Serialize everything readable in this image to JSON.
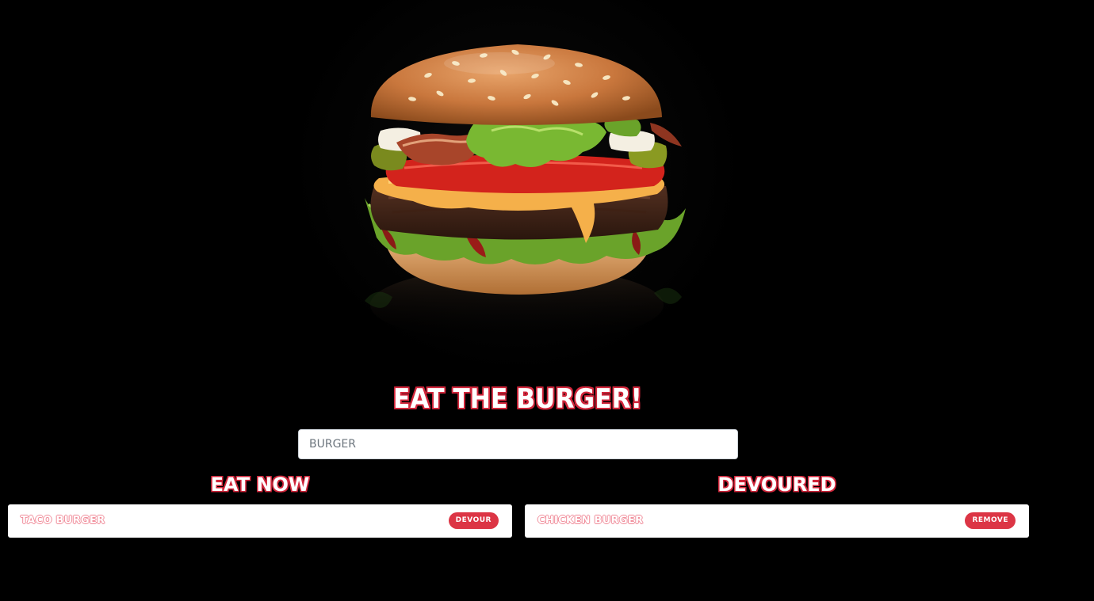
{
  "hero": {
    "image": "burger-photo"
  },
  "title": "EAT THE BURGER!",
  "form": {
    "input_placeholder": "BURGER",
    "input_value": ""
  },
  "eat_now": {
    "heading": "EAT NOW",
    "items": [
      {
        "name": "TACO BURGER",
        "button_label": "DEVOUR"
      }
    ]
  },
  "devoured": {
    "heading": "DEVOURED",
    "items": [
      {
        "name": "CHICKEN BURGER",
        "button_label": "REMOVE"
      }
    ]
  },
  "colors": {
    "background": "#000000",
    "accent": "#dc3545",
    "title_outline": "#d1263b",
    "item_outline": "#f08a98"
  }
}
